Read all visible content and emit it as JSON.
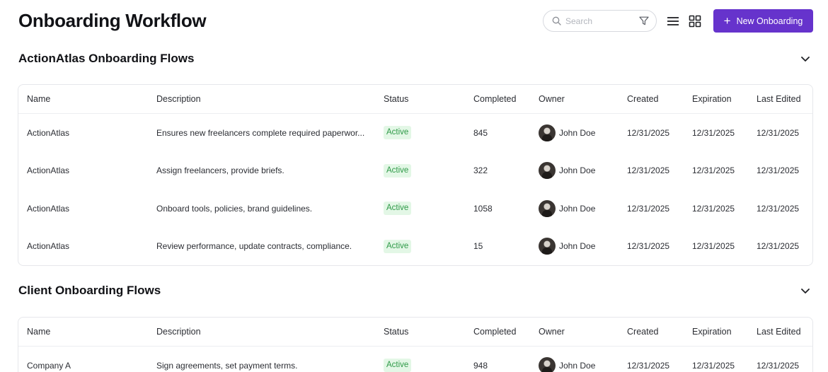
{
  "page_title": "Onboarding Workflow",
  "toolbar": {
    "search_placeholder": "Search",
    "filter_icon": "filter-icon",
    "list_view_icon": "list-view-icon",
    "grid_view_icon": "grid-view-icon",
    "new_button_label": "New Onboarding",
    "accent_color": "#6633cc"
  },
  "columns": [
    "Name",
    "Description",
    "Status",
    "Completed",
    "Owner",
    "Created",
    "Expiration",
    "Last Edited"
  ],
  "sections": [
    {
      "title": "ActionAtlas Onboarding Flows",
      "rows": [
        {
          "name": "ActionAtlas",
          "description": "Ensures new freelancers complete required paperwor...",
          "status": "Active",
          "completed": "845",
          "owner": "John Doe",
          "created": "12/31/2025",
          "expiration": "12/31/2025",
          "last_edited": "12/31/2025"
        },
        {
          "name": "ActionAtlas",
          "description": "Assign freelancers, provide briefs.",
          "status": "Active",
          "completed": "322",
          "owner": "John Doe",
          "created": "12/31/2025",
          "expiration": "12/31/2025",
          "last_edited": "12/31/2025"
        },
        {
          "name": "ActionAtlas",
          "description": "Onboard tools, policies, brand guidelines.",
          "status": "Active",
          "completed": "1058",
          "owner": "John Doe",
          "created": "12/31/2025",
          "expiration": "12/31/2025",
          "last_edited": "12/31/2025"
        },
        {
          "name": "ActionAtlas",
          "description": "Review performance, update contracts, compliance.",
          "status": "Active",
          "completed": "15",
          "owner": "John Doe",
          "created": "12/31/2025",
          "expiration": "12/31/2025",
          "last_edited": "12/31/2025"
        }
      ]
    },
    {
      "title": "Client Onboarding Flows",
      "rows": [
        {
          "name": "Company A",
          "description": "Sign agreements, set payment terms.",
          "status": "Active",
          "completed": "948",
          "owner": "John Doe",
          "created": "12/31/2025",
          "expiration": "12/31/2025",
          "last_edited": "12/31/2025"
        }
      ]
    }
  ]
}
